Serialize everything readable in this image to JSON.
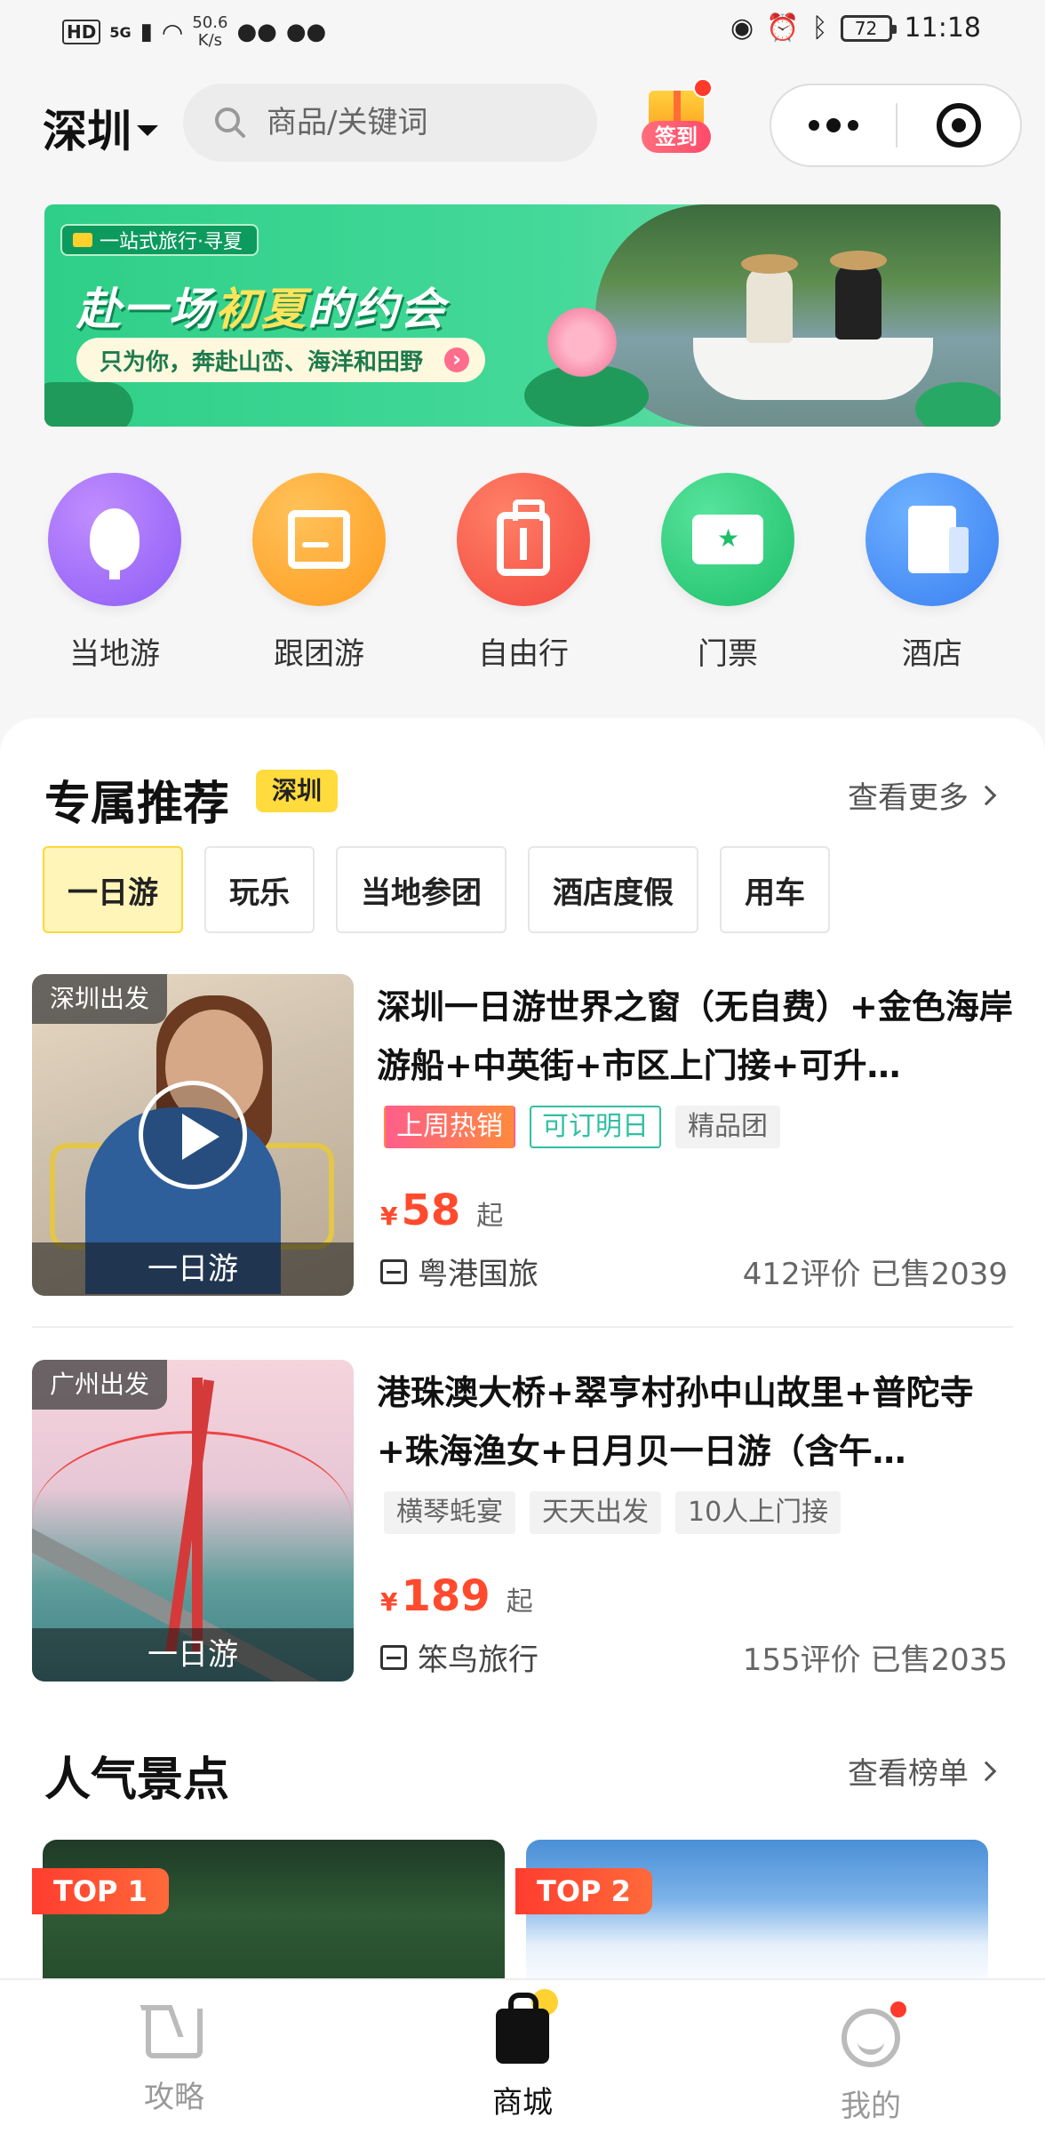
{
  "status_bar": {
    "hd": "HD",
    "network": "5G",
    "speed": "50.6",
    "speed_unit": "K/s",
    "battery": "72",
    "time": "11:18"
  },
  "header": {
    "city": "深圳",
    "search_placeholder": "商品/关键词",
    "checkin_label": "签到"
  },
  "banner": {
    "tag": "一站式旅行·寻夏",
    "title_prefix": "赴一场",
    "title_highlight": "初夏",
    "title_suffix": "的约会",
    "subtitle": "只为你，奔赴山峦、海洋和田野"
  },
  "categories": [
    {
      "label": "当地游",
      "icon": "balloon-icon"
    },
    {
      "label": "跟团游",
      "icon": "flag-icon"
    },
    {
      "label": "自由行",
      "icon": "luggage-icon"
    },
    {
      "label": "门票",
      "icon": "ticket-icon"
    },
    {
      "label": "酒店",
      "icon": "hotel-icon"
    }
  ],
  "recommend": {
    "title": "专属推荐",
    "badge": "深圳",
    "more": "查看更多",
    "tabs": [
      "一日游",
      "玩乐",
      "当地参团",
      "酒店度假",
      "用车"
    ],
    "active_tab": "一日游",
    "products": [
      {
        "depart": "深圳出发",
        "type": "一日游",
        "title": "深圳一日游世界之窗（无自费）+金色海岸游船+中英街+市区上门接+可升…",
        "tags": [
          {
            "text": "上周热销",
            "style": "hot"
          },
          {
            "text": "可订明日",
            "style": "mint"
          },
          {
            "text": "精品团",
            "style": "gray"
          }
        ],
        "currency": "¥",
        "price": "58",
        "price_suffix": "起",
        "shop": "粤港国旅",
        "stats": "412评价 已售2039"
      },
      {
        "depart": "广州出发",
        "type": "一日游",
        "title": "港珠澳大桥+翠亨村孙中山故里+普陀寺+珠海渔女+日月贝一日游（含午…",
        "tags": [
          {
            "text": "横琴蚝宴",
            "style": "gray"
          },
          {
            "text": "天天出发",
            "style": "gray"
          },
          {
            "text": "10人上门接",
            "style": "gray"
          }
        ],
        "currency": "¥",
        "price": "189",
        "price_suffix": "起",
        "shop": "笨鸟旅行",
        "stats": "155评价 已售2035"
      }
    ]
  },
  "popular": {
    "title": "人气景点",
    "more": "查看榜单",
    "badges": [
      "TOP 1",
      "TOP 2"
    ]
  },
  "bottom_nav": [
    {
      "label": "攻略",
      "icon": "guide-icon"
    },
    {
      "label": "商城",
      "icon": "shopping-bag-icon",
      "active": true
    },
    {
      "label": "我的",
      "icon": "profile-icon"
    }
  ]
}
